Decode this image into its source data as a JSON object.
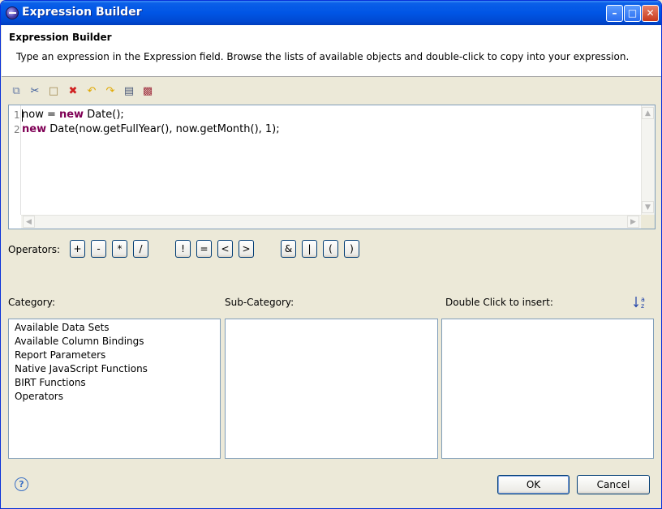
{
  "window": {
    "title": "Expression Builder"
  },
  "header": {
    "title": "Expression Builder",
    "description": "Type an expression in the Expression field. Browse the lists of available objects and double-click to copy into your expression."
  },
  "toolbar": {
    "icons": [
      "copy-icon",
      "cut-icon",
      "paste-icon",
      "delete-icon",
      "undo-icon",
      "redo-icon",
      "clipboard-icon",
      "preview-icon"
    ]
  },
  "editor": {
    "line_numbers": [
      "1",
      "2"
    ],
    "line1": {
      "var": "now = ",
      "kw": "new",
      "rest": " Date();"
    },
    "line2": {
      "kw": "new",
      "rest": " Date(now.getFullYear(), now.getMonth(), 1);"
    }
  },
  "operators": {
    "label": "Operators:",
    "buttons": [
      "+",
      "-",
      "*",
      "/",
      "!",
      "=",
      "<",
      ">",
      "&",
      "|",
      "(",
      ")"
    ]
  },
  "category": {
    "label": "Category:",
    "items": [
      "Available Data Sets",
      "Available Column Bindings",
      "Report Parameters",
      "Native JavaScript Functions",
      "BIRT Functions",
      "Operators"
    ]
  },
  "sub_category": {
    "label": "Sub-Category:"
  },
  "insert": {
    "label": "Double Click to insert:",
    "sort_icon": "sort-az-icon"
  },
  "footer": {
    "ok_label": "OK",
    "cancel_label": "Cancel",
    "help_icon": "help-icon"
  },
  "colors": {
    "titlebar": "#0055e5",
    "keyword": "#7f0055"
  }
}
